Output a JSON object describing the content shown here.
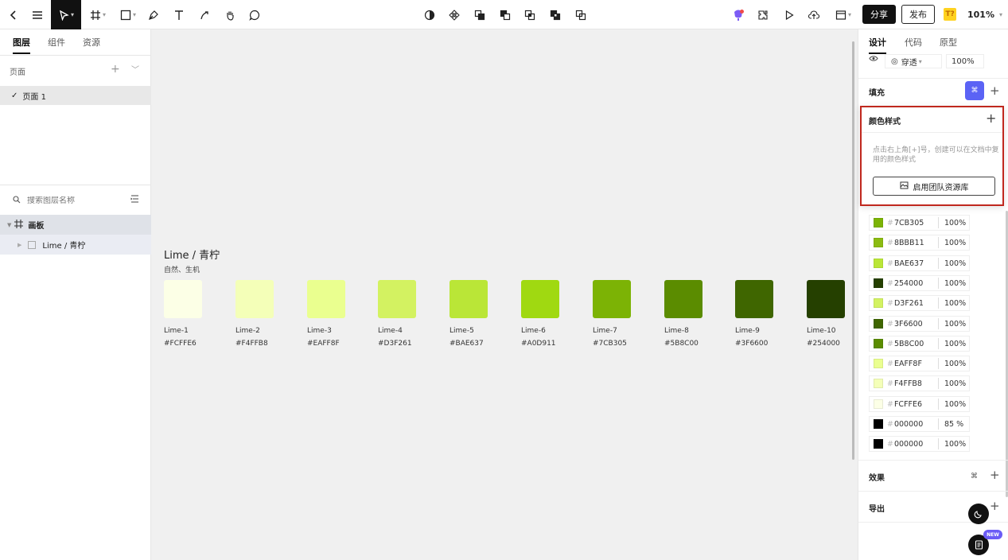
{
  "toolbar": {
    "left_icons": [
      "back-icon",
      "menu-icon",
      "move-tool-icon",
      "frame-tool-icon",
      "rectangle-tool-icon",
      "pen-tool-icon",
      "text-tool-icon",
      "pencil-tool-icon",
      "hand-tool-icon",
      "comment-tool-icon"
    ],
    "center_icons": [
      "contrast-icon",
      "component-icon",
      "boolean-union-icon",
      "boolean-subtract-icon",
      "boolean-intersect-icon",
      "boolean-exclude-icon",
      "boolean-flatten-icon"
    ],
    "right_icons": [
      "ai-icon",
      "plugin-icon",
      "play-icon",
      "upload-icon",
      "layout-icon"
    ],
    "share_label": "分享",
    "publish_label": "发布",
    "badge_label": "T?",
    "zoom": "101%"
  },
  "left_panel": {
    "tabs": [
      {
        "label": "图层",
        "active": true
      },
      {
        "label": "组件",
        "active": false
      },
      {
        "label": "资源",
        "active": false
      }
    ],
    "pages_heading": "页面",
    "pages": [
      {
        "label": "页面 1",
        "selected": true
      }
    ],
    "search_placeholder": "搜索图层名称",
    "layers": {
      "frame": {
        "label": "画板"
      },
      "child": {
        "label": "Lime / 青柠"
      }
    }
  },
  "canvas": {
    "title": "Lime / 青柠",
    "subtitle": "自然、生机",
    "swatches": [
      {
        "name": "Lime-1",
        "hex": "#FCFFE6",
        "color": "#FCFFE6"
      },
      {
        "name": "Lime-2",
        "hex": "#F4FFB8",
        "color": "#F4FFB8"
      },
      {
        "name": "Lime-3",
        "hex": "#EAFF8F",
        "color": "#EAFF8F"
      },
      {
        "name": "Lime-4",
        "hex": "#D3F261",
        "color": "#D3F261"
      },
      {
        "name": "Lime-5",
        "hex": "#BAE637",
        "color": "#BAE637"
      },
      {
        "name": "Lime-6",
        "hex": "#A0D911",
        "color": "#A0D911"
      },
      {
        "name": "Lime-7",
        "hex": "#7CB305",
        "color": "#7CB305"
      },
      {
        "name": "Lime-8",
        "hex": "#5B8C00",
        "color": "#5B8C00"
      },
      {
        "name": "Lime-9",
        "hex": "#3F6600",
        "color": "#3F6600"
      },
      {
        "name": "Lime-10",
        "hex": "#254000",
        "color": "#254000"
      }
    ]
  },
  "right_panel": {
    "tabs": [
      {
        "label": "设计",
        "active": true
      },
      {
        "label": "代码",
        "active": false
      },
      {
        "label": "原型",
        "active": false
      }
    ],
    "layer": {
      "blend_mode": "穿透",
      "opacity": "100%"
    },
    "fill_title": "填充",
    "fills": [
      {
        "hex": "7CB305",
        "opacity": "100%",
        "color": "#7CB305"
      },
      {
        "hex": "8BBB11",
        "opacity": "100%",
        "color": "#8BBB11"
      },
      {
        "hex": "BAE637",
        "opacity": "100%",
        "color": "#BAE637"
      },
      {
        "hex": "254000",
        "opacity": "100%",
        "color": "#254000"
      },
      {
        "hex": "D3F261",
        "opacity": "100%",
        "color": "#D3F261"
      },
      {
        "hex": "3F6600",
        "opacity": "100%",
        "color": "#3F6600"
      },
      {
        "hex": "5B8C00",
        "opacity": "100%",
        "color": "#5B8C00"
      },
      {
        "hex": "EAFF8F",
        "opacity": "100%",
        "color": "#EAFF8F"
      },
      {
        "hex": "F4FFB8",
        "opacity": "100%",
        "color": "#F4FFB8"
      },
      {
        "hex": "FCFFE6",
        "opacity": "100%",
        "color": "#FCFFE6"
      },
      {
        "hex": "000000",
        "opacity": "85 %",
        "color": "#000000"
      },
      {
        "hex": "000000",
        "opacity": "100%",
        "color": "#000000"
      }
    ],
    "effects_title": "效果",
    "export_title": "导出"
  },
  "color_styles_popover": {
    "title": "颜色样式",
    "description": "点击右上角[+]号，创建可以在文档中复用的颜色样式",
    "button_label": "启用团队资源库"
  },
  "floating": {
    "new_badge": "NEW"
  }
}
